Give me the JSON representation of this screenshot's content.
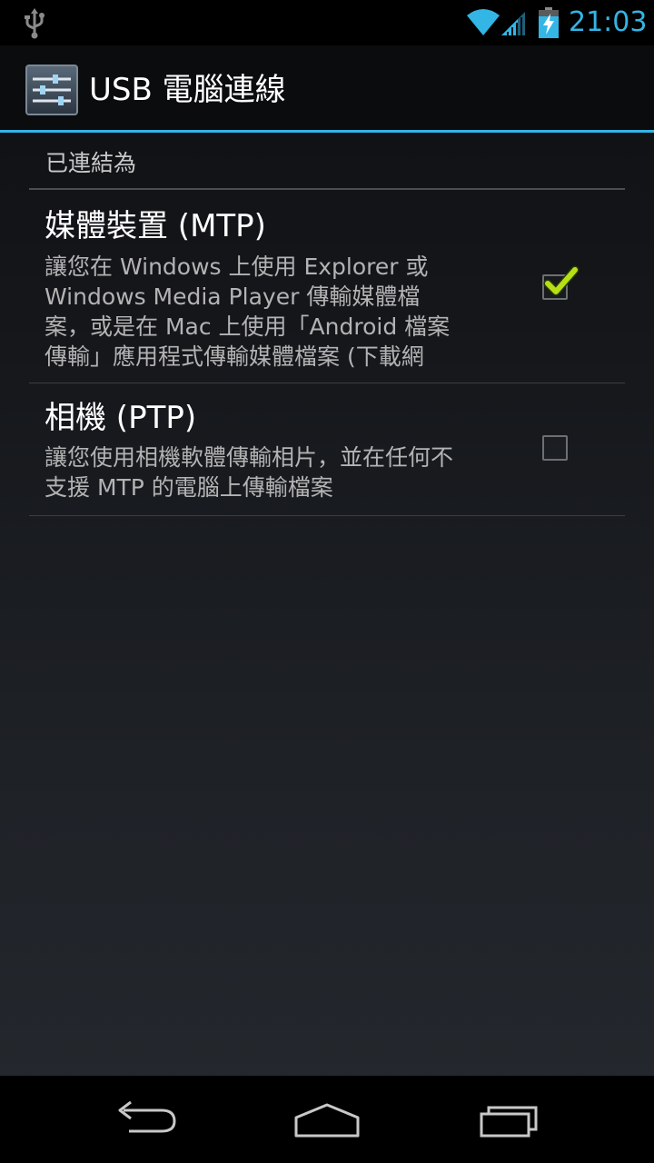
{
  "status_bar": {
    "time": "21:03",
    "icons": [
      "usb-icon",
      "wifi-icon",
      "cell-signal-icon",
      "battery-charging-icon"
    ],
    "accent_color": "#33b5e5"
  },
  "action_bar": {
    "title": "USB 電腦連線",
    "icon": "settings-sliders-icon"
  },
  "section": {
    "header": "已連結為"
  },
  "preferences": [
    {
      "title": "媒體裝置 (MTP)",
      "summary_lines": [
        "讓您在 Windows 上使用 Explorer 或",
        "Windows Media Player 傳輸媒體檔",
        "案，或是在 Mac 上使用「Android 檔案",
        "傳輸」應用程式傳輸媒體檔案 (下載網"
      ],
      "checked": true
    },
    {
      "title": "相機 (PTP)",
      "summary_lines": [
        "讓您使用相機軟體傳輸相片，並在任何不",
        "支援 MTP 的電腦上傳輸檔案"
      ],
      "checked": false
    }
  ],
  "nav_bar": {
    "buttons": [
      "back-icon",
      "home-icon",
      "recent-apps-icon"
    ]
  }
}
